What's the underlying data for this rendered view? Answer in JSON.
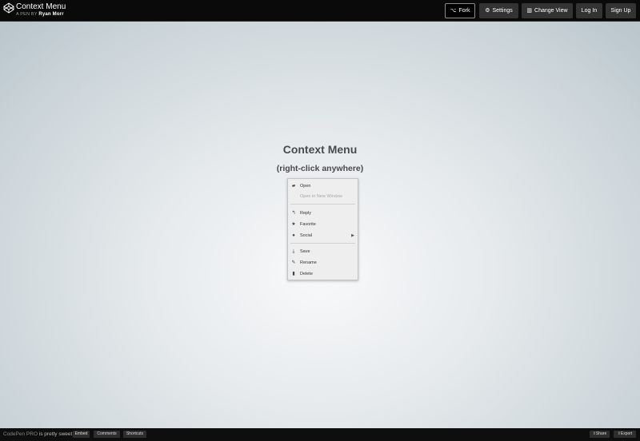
{
  "header": {
    "pen_title": "Context Menu",
    "author_prefix": "A PEN BY",
    "author_name": "Ryan Morr",
    "buttons": {
      "fork": "Fork",
      "settings": "Settings",
      "change_view": "Change View",
      "login": "Log In",
      "signup": "Sign Up"
    }
  },
  "stage": {
    "heading": "Context Menu",
    "subheading": "(right-click anywhere)"
  },
  "menu": {
    "items": [
      {
        "label": "Open",
        "icon": "folder-open-icon",
        "disabled": false
      },
      {
        "label": "Open in New Window",
        "icon": "",
        "disabled": true
      },
      {
        "label": "Reply",
        "icon": "reply-icon",
        "disabled": false
      },
      {
        "label": "Favorite",
        "icon": "star-icon",
        "disabled": false
      },
      {
        "label": "Social",
        "icon": "users-icon",
        "disabled": false,
        "has_submenu": true
      },
      {
        "label": "Save",
        "icon": "download-icon",
        "disabled": false
      },
      {
        "label": "Rename",
        "icon": "edit-icon",
        "disabled": false
      },
      {
        "label": "Delete",
        "icon": "trash-icon",
        "disabled": false
      }
    ]
  },
  "footer": {
    "promo_brand": "CodePen PRO",
    "promo_text": " is pretty sweet.",
    "buttons": {
      "embed": "Embed",
      "comments": "Comments",
      "shortcuts": "Shortcuts",
      "share": "Share",
      "export": "Export"
    }
  },
  "colors": {
    "header_bg": "#0a0a0a",
    "button_bg": "#333333",
    "menu_bg": "#eeeeee",
    "heading_text": "#4a4a4a"
  }
}
